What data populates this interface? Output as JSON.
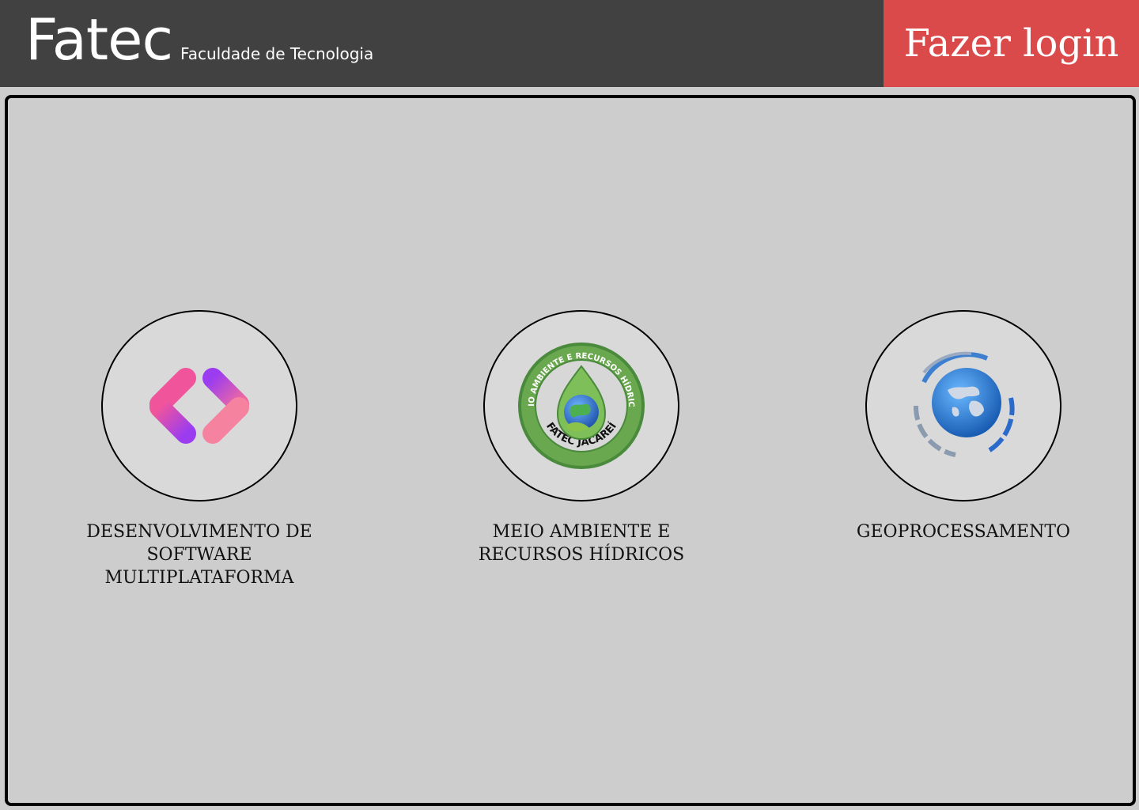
{
  "header": {
    "brand_name": "Fatec",
    "brand_subtitle": "Faculdade de Tecnologia",
    "login_label": "Fazer login",
    "colors": {
      "bar": "#414141",
      "login": "#db4a4a"
    }
  },
  "courses": [
    {
      "icon": "code-brackets-icon",
      "label": "DESENVOLVIMENTO DE\nSOFTWARE\nMULTIPLATAFORMA"
    },
    {
      "icon": "environment-seal-icon",
      "label": "MEIO AMBIENTE    E\nRECURSOS HÍDRICOS",
      "seal_ring_text": "MEIO AMBIENTE E RECURSOS HÍDRICOS",
      "seal_bottom_text": "FATEC JACAREÍ"
    },
    {
      "icon": "globe-icon",
      "label": "GEOPROCESSAMENTO"
    }
  ]
}
